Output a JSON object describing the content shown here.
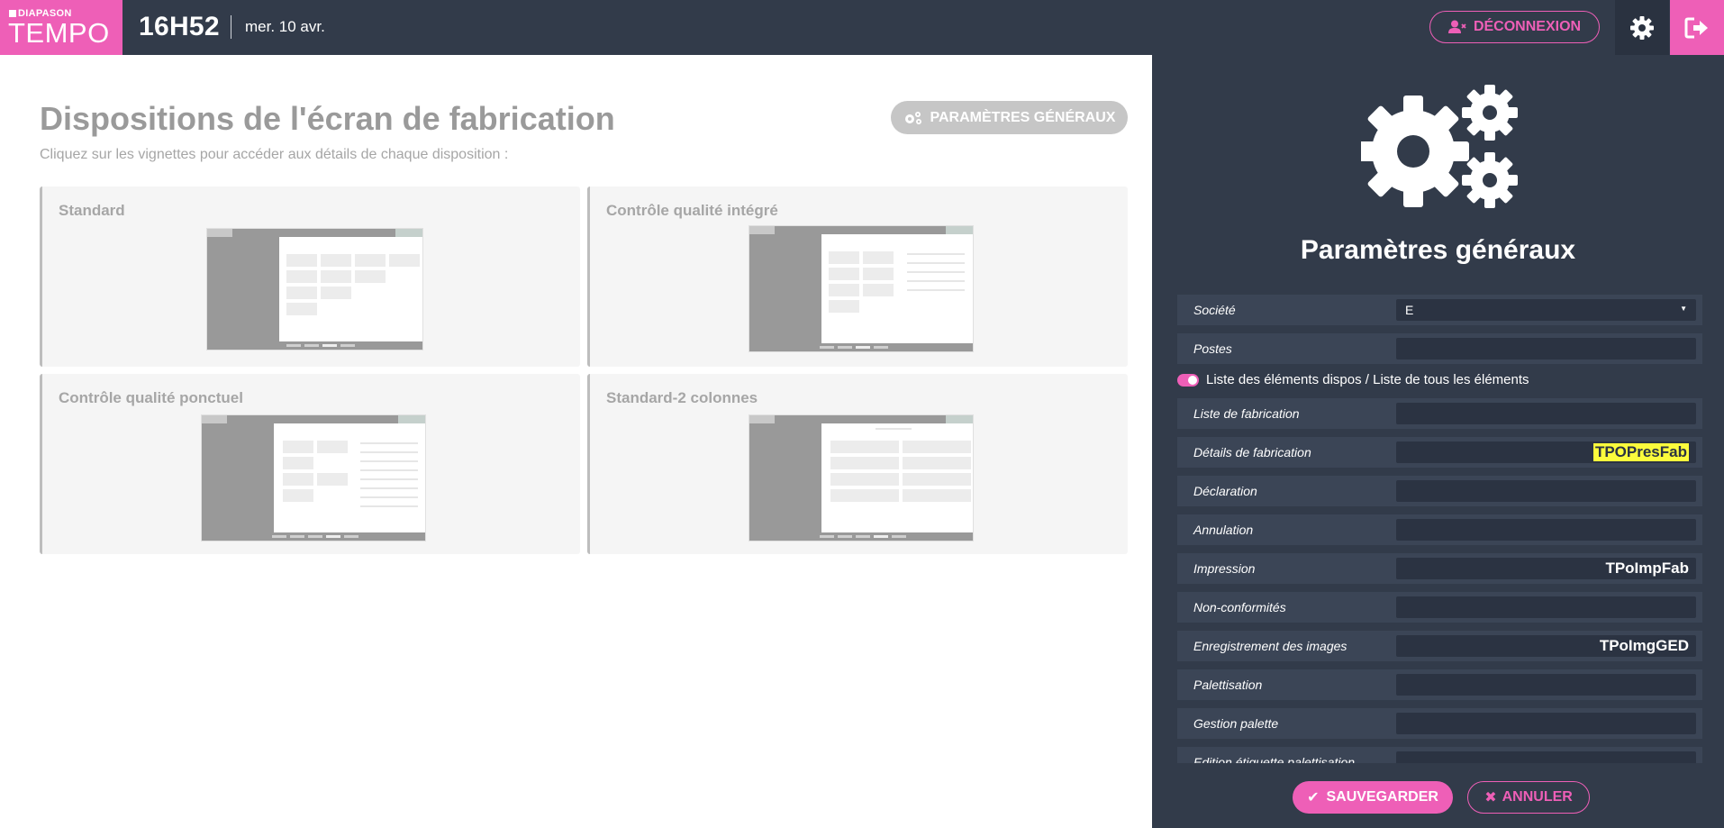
{
  "header": {
    "logo_top": "DIAPASON",
    "logo_main": "TEMPO",
    "time": "16H52",
    "date": "mer. 10 avr.",
    "logout_label": "DÉCONNEXION"
  },
  "main": {
    "title": "Dispositions de l'écran de fabrication",
    "subtitle": "Cliquez sur les vignettes pour accéder aux détails de chaque disposition :",
    "params_button": "PARAMÈTRES GÉNÉRAUX",
    "layouts": [
      {
        "title": "Standard"
      },
      {
        "title": "Contrôle qualité intégré"
      },
      {
        "title": "Contrôle qualité ponctuel"
      },
      {
        "title": "Standard-2 colonnes"
      }
    ]
  },
  "panel": {
    "title": "Paramètres généraux",
    "toggle_label": "Liste des éléments dispos / Liste de tous les éléments",
    "rows": [
      {
        "label": "Société",
        "value": "E",
        "type": "select"
      },
      {
        "label": "Postes",
        "value": ""
      },
      {
        "label": "Liste de fabrication",
        "value": ""
      },
      {
        "label": "Détails de fabrication",
        "value": "TPOPresFab",
        "highlight": true
      },
      {
        "label": "Déclaration",
        "value": ""
      },
      {
        "label": "Annulation",
        "value": ""
      },
      {
        "label": "Impression",
        "value": "TPoImpFab"
      },
      {
        "label": "Non-conformités",
        "value": ""
      },
      {
        "label": "Enregistrement des images",
        "value": "TPoImgGED"
      },
      {
        "label": "Palettisation",
        "value": ""
      },
      {
        "label": "Gestion palette",
        "value": ""
      },
      {
        "label": "Edition étiquette palettisation",
        "value": ""
      }
    ],
    "save_label": "SAUVEGARDER",
    "cancel_label": "ANNULER"
  },
  "colors": {
    "accent": "#ee5fb7",
    "dark": "#323b4a",
    "highlight": "#fcfc3c"
  }
}
